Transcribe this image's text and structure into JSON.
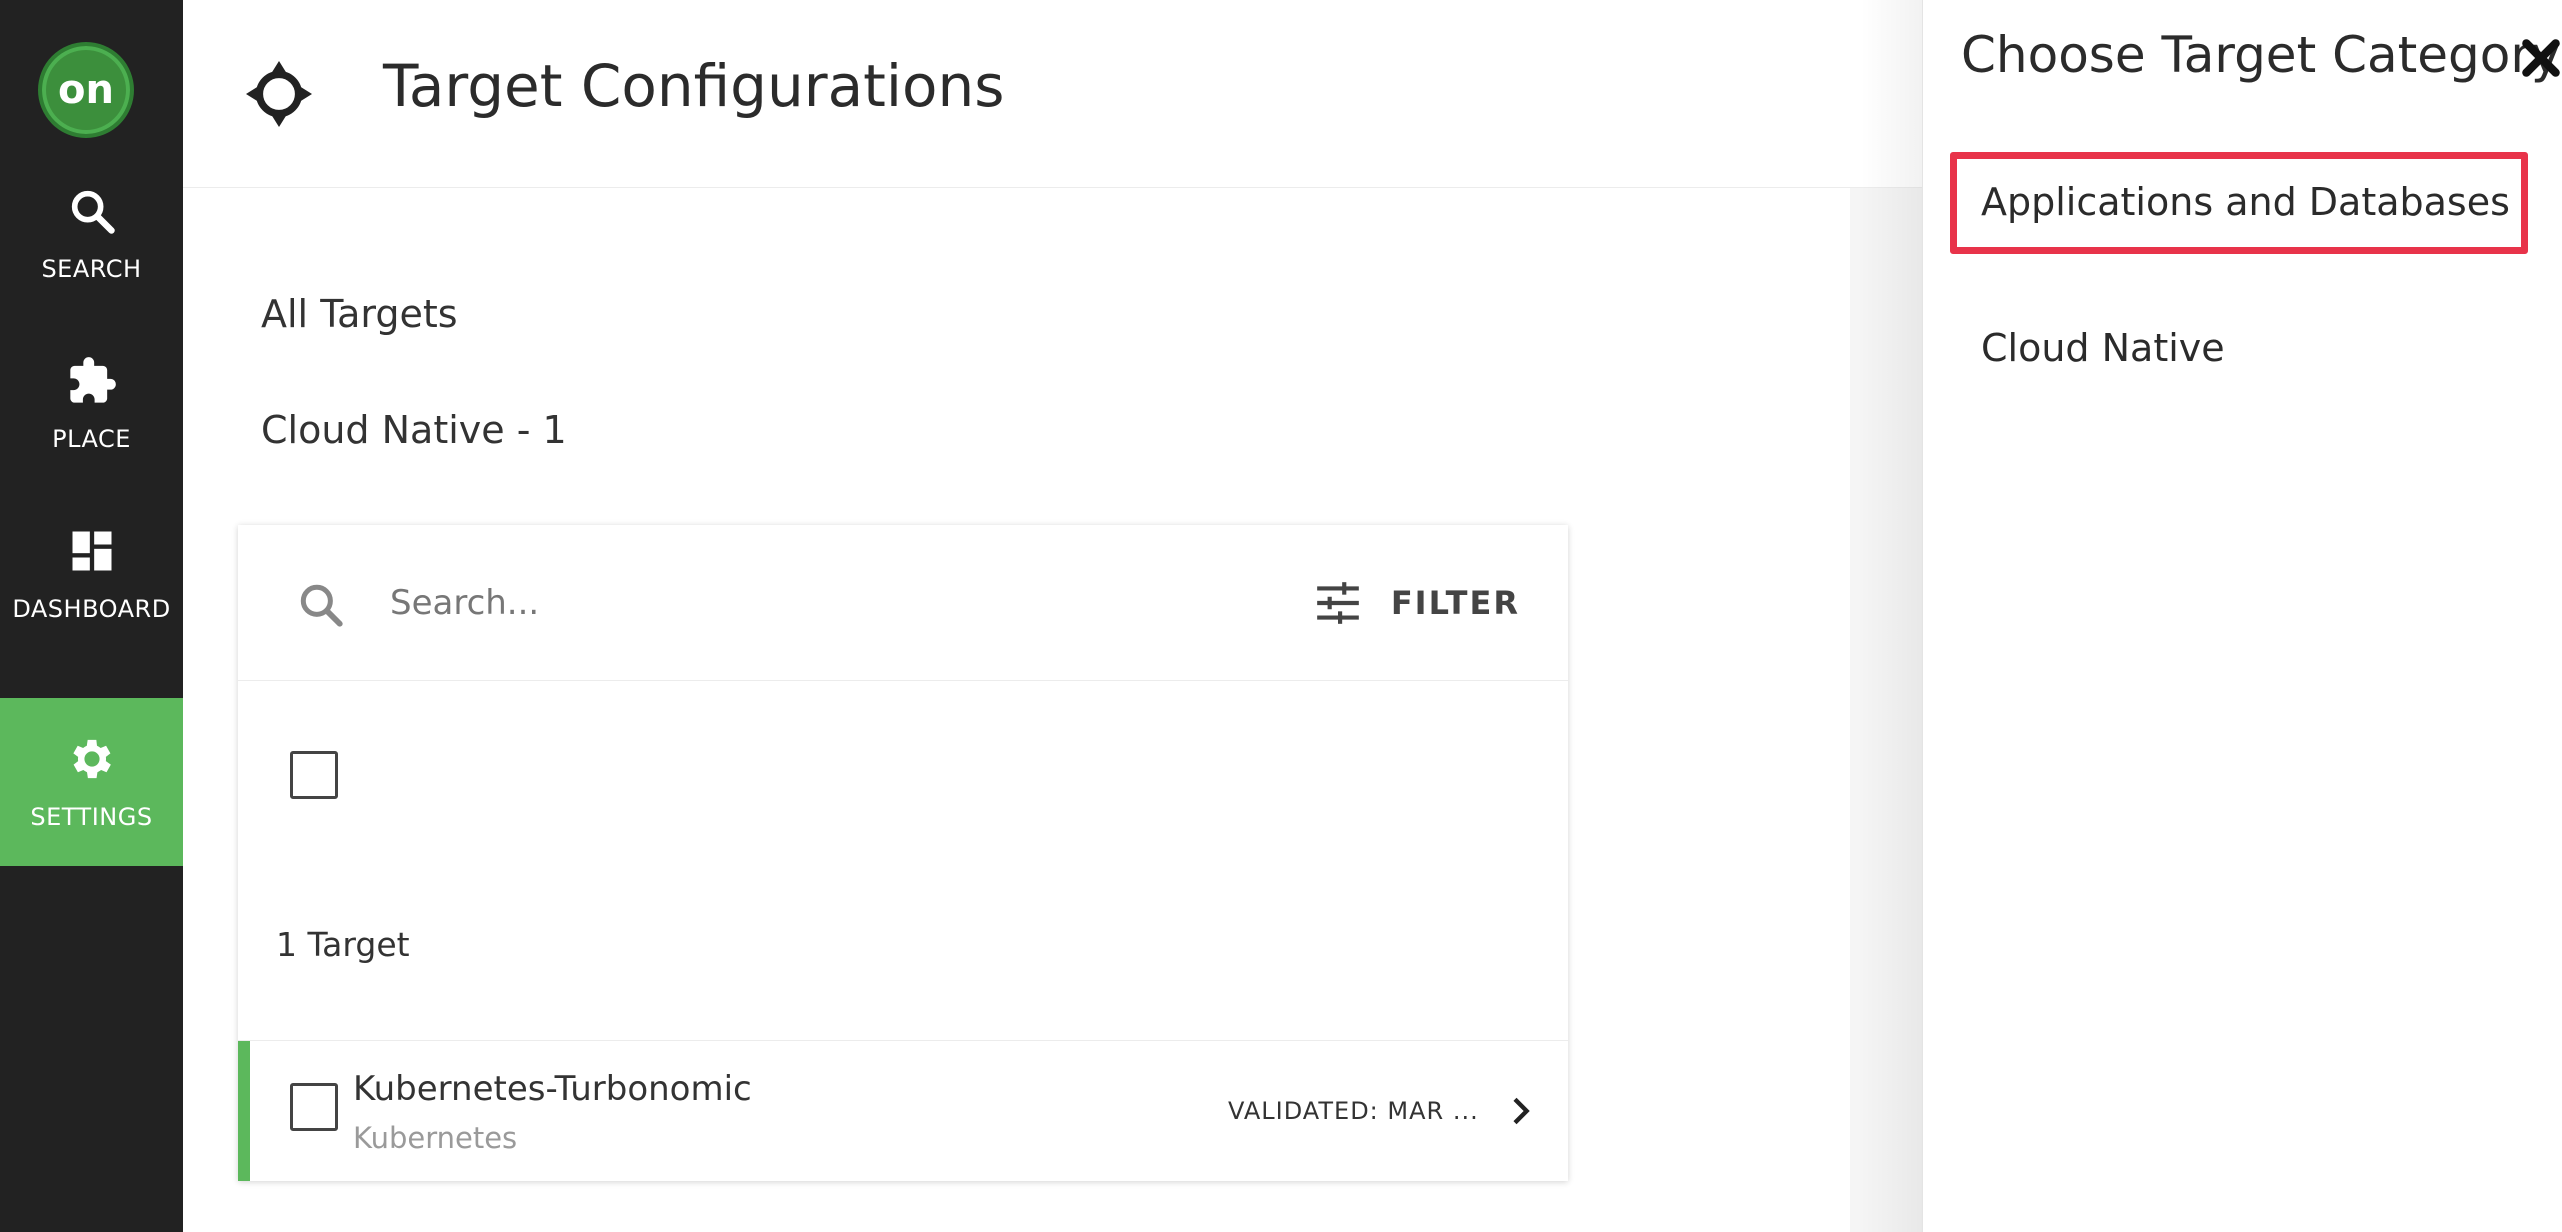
{
  "nav": {
    "logo_text": "on",
    "items": [
      {
        "label": "SEARCH",
        "icon": "search-icon"
      },
      {
        "label": "PLACE",
        "icon": "puzzle-icon"
      },
      {
        "label": "DASHBOARD",
        "icon": "dashboard-icon"
      },
      {
        "label": "SETTINGS",
        "icon": "gear-icon",
        "active": true
      }
    ]
  },
  "header": {
    "title": "Target Configurations",
    "icon": "crosshair-icon"
  },
  "categories": {
    "all": "All Targets",
    "cloud_native": "Cloud Native - 1"
  },
  "list": {
    "search_placeholder": "Search...",
    "filter_label": "FILTER",
    "count_label": "1 Target",
    "rows": [
      {
        "name": "Kubernetes-Turbonomic",
        "type": "Kubernetes",
        "status": "VALIDATED: MAR ..."
      }
    ]
  },
  "panel": {
    "title": "Choose Target Category",
    "items": [
      "Applications and Databases",
      "Cloud Native"
    ],
    "selected_index": 0
  },
  "colors": {
    "nav_bg": "#222222",
    "accent_green": "#5cb85c",
    "highlight_red": "#e8334a"
  }
}
